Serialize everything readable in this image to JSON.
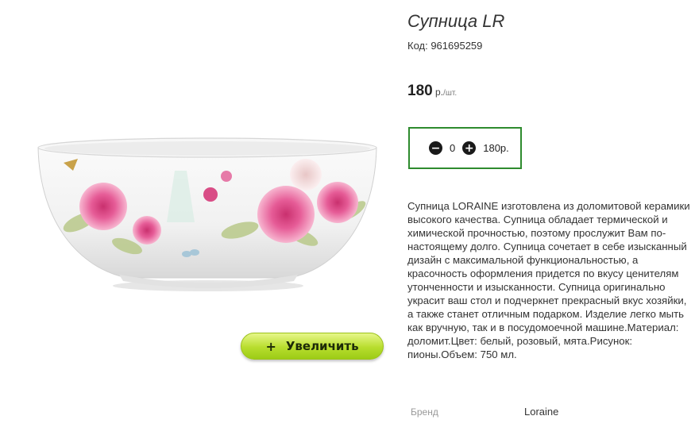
{
  "product": {
    "title": "Супница LR",
    "sku": "Код: 961695259",
    "price": {
      "amount": "180",
      "currency": " р.",
      "unit": "/шт."
    },
    "description": "Супница LORAINE изготовлена из доломитовой керамики высокого качества. Супница обладает термической и химической прочностью, поэтому прослужит Вам по-настоящему долго. Супница сочетает в себе изысканный дизайн с максимальной функциональностью, а красочность оформления придется по вкусу ценителям утонченности и изысканности. Супница оригинально украсит ваш стол и подчеркнет прекрасный вкус хозяйки, а также станет отличным подарком. Изделие легко мыть как вручную, так и в посудомоечной машине.Материал: доломит.Цвет: белый, розовый, мята.Рисунок: пионы.Объем: 750 мл."
  },
  "quantity": {
    "minus_icon": "minus-circle-icon",
    "value": "0",
    "plus_icon": "plus-circle-icon",
    "total": "180р.",
    "border_color": "#2e8b2e"
  },
  "image": {
    "zoom_button": {
      "icon": "+",
      "label": "Увеличить",
      "color": "#b8dd2e"
    }
  },
  "specs": [
    {
      "label": "Бренд",
      "value": "Loraine"
    }
  ]
}
